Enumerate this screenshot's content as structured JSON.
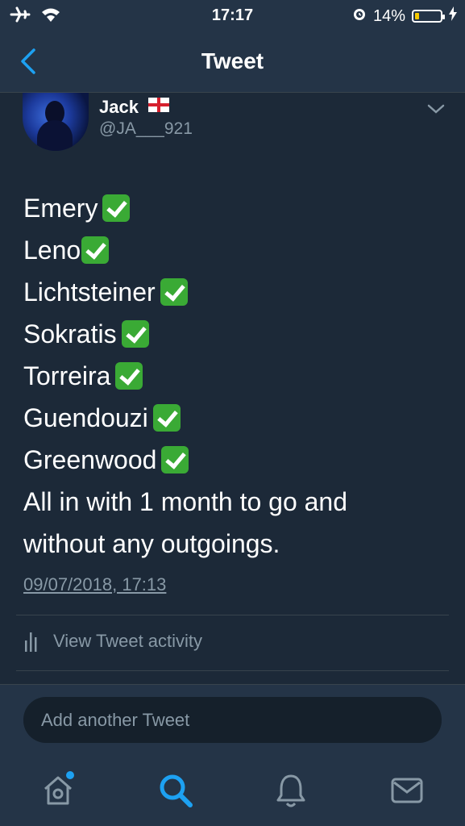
{
  "status_bar": {
    "time": "17:17",
    "battery_percent": "14%",
    "battery_level": 0.14,
    "icons": [
      "airplane-icon",
      "wifi-icon",
      "alarm-icon",
      "battery-icon",
      "charging-bolt-icon"
    ]
  },
  "nav": {
    "title": "Tweet",
    "back_icon": "chevron-left-icon"
  },
  "tweet": {
    "author_name": "Jack",
    "author_flag": "england-flag-icon",
    "author_handle": "@JA___921",
    "lines": [
      {
        "text": "Emery",
        "check": true
      },
      {
        "text": "Leno",
        "check": true
      },
      {
        "text": "Lichtsteiner",
        "check": true
      },
      {
        "text": "Sokratis",
        "check": true
      },
      {
        "text": "Torreira",
        "check": true
      },
      {
        "text": "Guendouzi",
        "check": true
      },
      {
        "text": "Greenwood",
        "check": true
      },
      {
        "text": "All in with 1 month to go and",
        "check": false
      },
      {
        "text": "without any outgoings.",
        "check": false
      }
    ],
    "timestamp": "09/07/2018, 17:13",
    "activity_label": "View Tweet activity"
  },
  "composer": {
    "placeholder": "Add another Tweet"
  },
  "tabs": [
    "home-icon",
    "search-icon",
    "notifications-icon",
    "messages-icon"
  ],
  "colors": {
    "background": "#15202b",
    "bar": "#243447",
    "accent": "#1da1f2",
    "secondary_text": "#8899a6",
    "check": "#3aaa35",
    "battery": "#f6c900"
  }
}
